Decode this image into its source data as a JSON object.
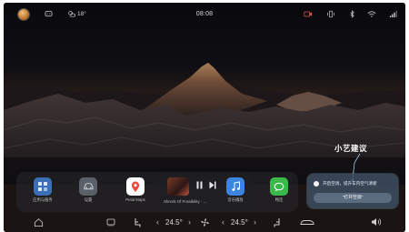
{
  "status_bar": {
    "weather_temp": "18°",
    "clock": "08:08",
    "icons": [
      "avatar",
      "chat-icon",
      "weather-icon",
      "dashcam-icon",
      "vibrate-icon",
      "bluetooth-icon",
      "wifi-icon",
      "signal-icon"
    ]
  },
  "dock": {
    "apps": [
      {
        "name": "app-store",
        "label": "应用与服务",
        "color": "#3a6fb5"
      },
      {
        "name": "car-settings",
        "label": "设置",
        "color": "#5a5f6a"
      },
      {
        "name": "petal-maps",
        "label": "Petal Maps",
        "color": "#ffffff"
      },
      {
        "name": "music-app",
        "label": "音乐播放",
        "color": "#3b84e0"
      },
      {
        "name": "messages",
        "label": "畅连",
        "color": "#3ab84a"
      }
    ]
  },
  "music": {
    "track": "Shreds Of Possibility - ...",
    "play_state": "paused"
  },
  "suggestion": {
    "title": "小艺建议",
    "text": "开启空调，提升车内空气清新",
    "action_label": "\"打开空调\""
  },
  "climate": {
    "driver_temp": "24.5°",
    "passenger_temp": "24.5°"
  },
  "colors": {
    "accent": "#3b84e0",
    "card_bg": "#3e4e62"
  }
}
